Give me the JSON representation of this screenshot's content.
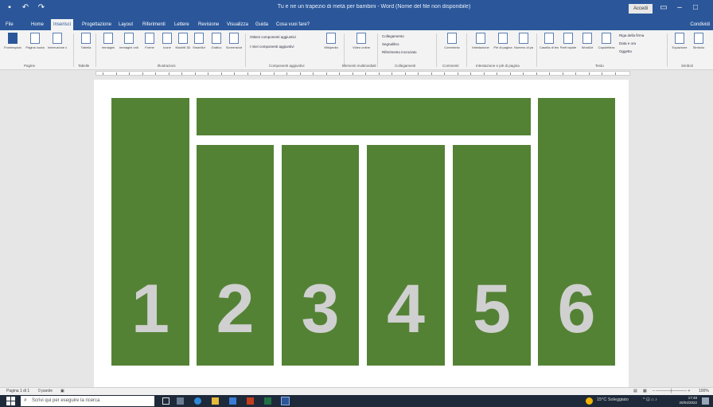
{
  "window": {
    "title": "Tu e ne un trapezio di metà per bambini - Word (Nome del file non disponibile)",
    "signin_label": "Accedi",
    "colors": {
      "word_blue": "#2b579a",
      "block_green": "#548235",
      "number_gray": "#d0d0d0"
    }
  },
  "quick_access": {
    "save_icon": "save-icon",
    "undo_icon": "undo-icon",
    "redo_icon": "redo-icon"
  },
  "tabs": [
    {
      "label": "File"
    },
    {
      "label": "Home"
    },
    {
      "label": "Inserisci",
      "active": true
    },
    {
      "label": "Progettazione"
    },
    {
      "label": "Layout"
    },
    {
      "label": "Riferimenti"
    },
    {
      "label": "Lettere"
    },
    {
      "label": "Revisione"
    },
    {
      "label": "Visualizza"
    },
    {
      "label": "Guida"
    },
    {
      "label": "Cosa vuoi fare?"
    }
  ],
  "share_label": "Condividi",
  "ribbon": {
    "groups": [
      {
        "label": "Pagine"
      },
      {
        "label": "Tabelle"
      },
      {
        "label": "Illustrazioni"
      },
      {
        "label": "Componenti aggiuntivi"
      },
      {
        "label": "Elementi multimediali"
      },
      {
        "label": "Collegamenti"
      },
      {
        "label": "Commenti"
      },
      {
        "label": "Intestazione e piè di pagina"
      },
      {
        "label": "Testo"
      },
      {
        "label": "Simboli"
      }
    ],
    "buttons": [
      {
        "label": "Frontespizio"
      },
      {
        "label": "Pagina vuota"
      },
      {
        "label": "Interruzione di pagina"
      },
      {
        "label": "Tabella"
      },
      {
        "label": "Immagini"
      },
      {
        "label": "Immagini online"
      },
      {
        "label": "Forme"
      },
      {
        "label": "Icone"
      },
      {
        "label": "Modelli 3D"
      },
      {
        "label": "SmartArt"
      },
      {
        "label": "Grafico"
      },
      {
        "label": "Screenshot"
      },
      {
        "label": "Wikipedia"
      },
      {
        "label": "Video online"
      },
      {
        "label": "Commento"
      },
      {
        "label": "Intestazione"
      },
      {
        "label": "Piè di pagina"
      },
      {
        "label": "Numero di pagina"
      },
      {
        "label": "Casella di testo"
      },
      {
        "label": "Parti rapide"
      },
      {
        "label": "WordArt"
      },
      {
        "label": "Capolettera"
      },
      {
        "label": "Equazione"
      },
      {
        "label": "Simbolo"
      }
    ],
    "small_items": {
      "addins_get": "Ottieni componenti aggiuntivi",
      "addins_mine": "I miei componenti aggiuntivi",
      "link": "Collegamento",
      "bookmark": "Segnalibro",
      "crossref": "Riferimento incrociato",
      "signature": "Riga della firma",
      "datetime": "Data e ora",
      "object": "Oggetto"
    }
  },
  "document": {
    "blocks": [
      {
        "name": "block-1",
        "number": "1"
      },
      {
        "name": "block-top"
      },
      {
        "name": "block-2",
        "number": "2"
      },
      {
        "name": "block-3",
        "number": "3"
      },
      {
        "name": "block-4",
        "number": "4"
      },
      {
        "name": "block-5",
        "number": "5"
      },
      {
        "name": "block-6",
        "number": "6"
      }
    ]
  },
  "status": {
    "page": "Pagina 1 di 1",
    "words": "0 parole",
    "zoom": "100%"
  },
  "taskbar": {
    "search_placeholder": "Scrivi qui per eseguire la ricerca",
    "weather": "15°C Soleggiato",
    "time": "17:48",
    "date": "20/04/2022"
  }
}
